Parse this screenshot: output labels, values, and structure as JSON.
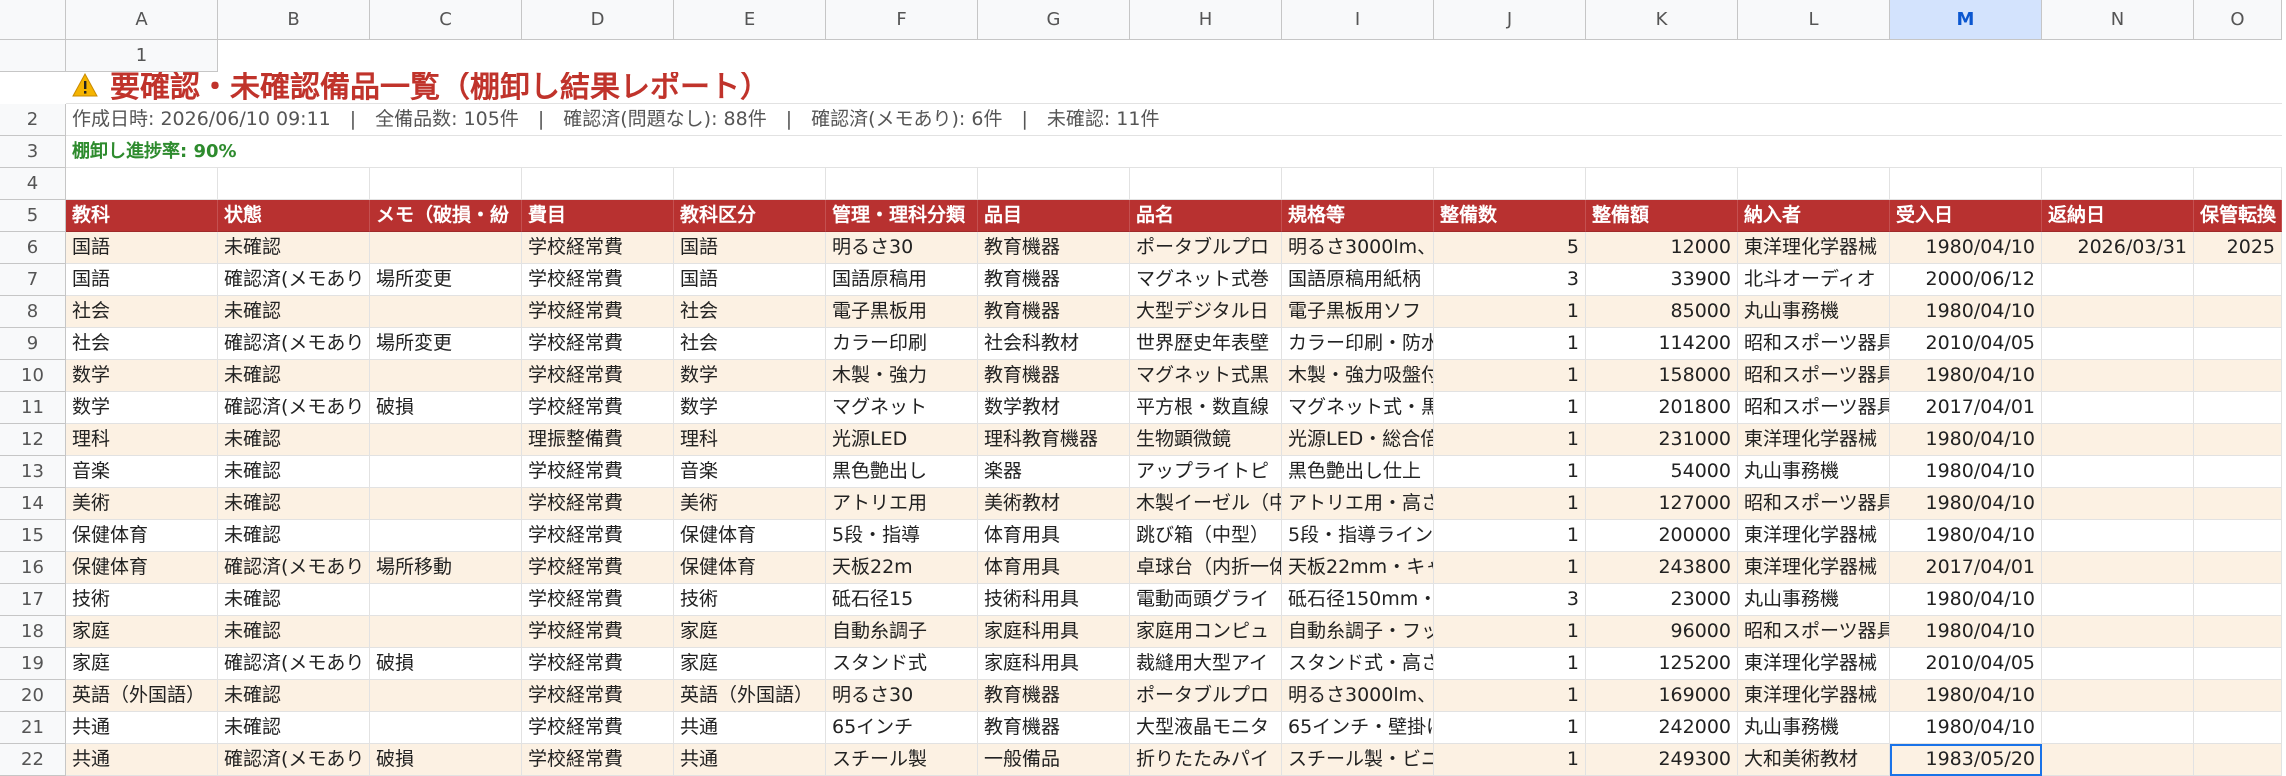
{
  "sheet": {
    "columns": [
      "A",
      "B",
      "C",
      "D",
      "E",
      "F",
      "G",
      "H",
      "I",
      "J",
      "K",
      "L",
      "M",
      "N",
      "O"
    ],
    "selected_column": "M",
    "title": "要確認・未確認備品一覧（棚卸し結果レポート）",
    "summary": "作成日時: 2026/06/10 09:11　|　全備品数: 105件　|　確認済(問題なし): 88件　|　確認済(メモあり): 6件　|　未確認: 11件",
    "progress": "棚卸し進捗率: 90%",
    "headers": [
      "教科",
      "状態",
      "メモ（破損・紛",
      "費目",
      "教科区分",
      "管理・理科分類",
      "品目",
      "品名",
      "規格等",
      "整備数",
      "整備額",
      "納入者",
      "受入日",
      "返納日",
      "保管転換"
    ],
    "rows": [
      [
        "国語",
        "未確認",
        "",
        "学校経常費",
        "国語",
        "明るさ30",
        "教育機器",
        "ポータブルプロ",
        "明るさ3000lm、",
        "5",
        "12000",
        "東洋理化学器械",
        "1980/04/10",
        "2026/03/31",
        "2025"
      ],
      [
        "国語",
        "確認済(メモあり",
        "場所変更",
        "学校経常費",
        "国語",
        "国語原稿用",
        "教育機器",
        "マグネット式巻",
        "国語原稿用紙柄",
        "3",
        "33900",
        "北斗オーディオ",
        "2000/06/12",
        "",
        ""
      ],
      [
        "社会",
        "未確認",
        "",
        "学校経常費",
        "社会",
        "電子黒板用",
        "教育機器",
        "大型デジタル日",
        "電子黒板用ソフ",
        "1",
        "85000",
        "丸山事務機",
        "1980/04/10",
        "",
        ""
      ],
      [
        "社会",
        "確認済(メモあり",
        "場所変更",
        "学校経常費",
        "社会",
        "カラー印刷",
        "社会科教材",
        "世界歴史年表壁",
        "カラー印刷・防水",
        "1",
        "114200",
        "昭和スポーツ器具",
        "2010/04/05",
        "",
        ""
      ],
      [
        "数学",
        "未確認",
        "",
        "学校経常費",
        "数学",
        "木製・強力",
        "教育機器",
        "マグネット式黒",
        "木製・強力吸盤付",
        "1",
        "158000",
        "昭和スポーツ器具",
        "1980/04/10",
        "",
        ""
      ],
      [
        "数学",
        "確認済(メモあり",
        "破損",
        "学校経常費",
        "数学",
        "マグネット",
        "数学教材",
        "平方根・数直線",
        "マグネット式・黒",
        "1",
        "201800",
        "昭和スポーツ器具",
        "2017/04/01",
        "",
        ""
      ],
      [
        "理科",
        "未確認",
        "",
        "理振整備費",
        "理科",
        "光源LED",
        "理科教育機器",
        "生物顕微鏡",
        "光源LED・総合倍",
        "1",
        "231000",
        "東洋理化学器械",
        "1980/04/10",
        "",
        ""
      ],
      [
        "音楽",
        "未確認",
        "",
        "学校経常費",
        "音楽",
        "黒色艶出し",
        "楽器",
        "アップライトピ",
        "黒色艶出し仕上",
        "1",
        "54000",
        "丸山事務機",
        "1980/04/10",
        "",
        ""
      ],
      [
        "美術",
        "未確認",
        "",
        "学校経常費",
        "美術",
        "アトリエ用",
        "美術教材",
        "木製イーゼル（中",
        "アトリエ用・高さ",
        "1",
        "127000",
        "昭和スポーツ器具",
        "1980/04/10",
        "",
        ""
      ],
      [
        "保健体育",
        "未確認",
        "",
        "学校経常費",
        "保健体育",
        "5段・指導",
        "体育用具",
        "跳び箱（中型）",
        "5段・指導ライン",
        "1",
        "200000",
        "東洋理化学器械",
        "1980/04/10",
        "",
        ""
      ],
      [
        "保健体育",
        "確認済(メモあり",
        "場所移動",
        "学校経常費",
        "保健体育",
        "天板22m",
        "体育用具",
        "卓球台（内折一体",
        "天板22mm・キャ",
        "1",
        "243800",
        "東洋理化学器械",
        "2017/04/01",
        "",
        ""
      ],
      [
        "技術",
        "未確認",
        "",
        "学校経常費",
        "技術",
        "砥石径15",
        "技術科用具",
        "電動両頭グライ",
        "砥石径150mm・",
        "3",
        "23000",
        "丸山事務機",
        "1980/04/10",
        "",
        ""
      ],
      [
        "家庭",
        "未確認",
        "",
        "学校経常費",
        "家庭",
        "自動糸調子",
        "家庭科用具",
        "家庭用コンピュ",
        "自動糸調子・フッ",
        "1",
        "96000",
        "昭和スポーツ器具",
        "1980/04/10",
        "",
        ""
      ],
      [
        "家庭",
        "確認済(メモあり",
        "破損",
        "学校経常費",
        "家庭",
        "スタンド式",
        "家庭科用具",
        "裁縫用大型アイ",
        "スタンド式・高さ",
        "1",
        "125200",
        "東洋理化学器械",
        "2010/04/05",
        "",
        ""
      ],
      [
        "英語（外国語）",
        "未確認",
        "",
        "学校経常費",
        "英語（外国語）",
        "明るさ30",
        "教育機器",
        "ポータブルプロ",
        "明るさ3000lm、",
        "1",
        "169000",
        "東洋理化学器械",
        "1980/04/10",
        "",
        ""
      ],
      [
        "共通",
        "未確認",
        "",
        "学校経常費",
        "共通",
        "65インチ",
        "教育機器",
        "大型液晶モニタ",
        "65インチ・壁掛け",
        "1",
        "242000",
        "丸山事務機",
        "1980/04/10",
        "",
        ""
      ],
      [
        "共通",
        "確認済(メモあり",
        "破損",
        "学校経常費",
        "共通",
        "スチール製",
        "一般備品",
        "折りたたみパイ",
        "スチール製・ビニ",
        "1",
        "249300",
        "大和美術教材",
        "1983/05/20",
        "",
        ""
      ]
    ]
  }
}
